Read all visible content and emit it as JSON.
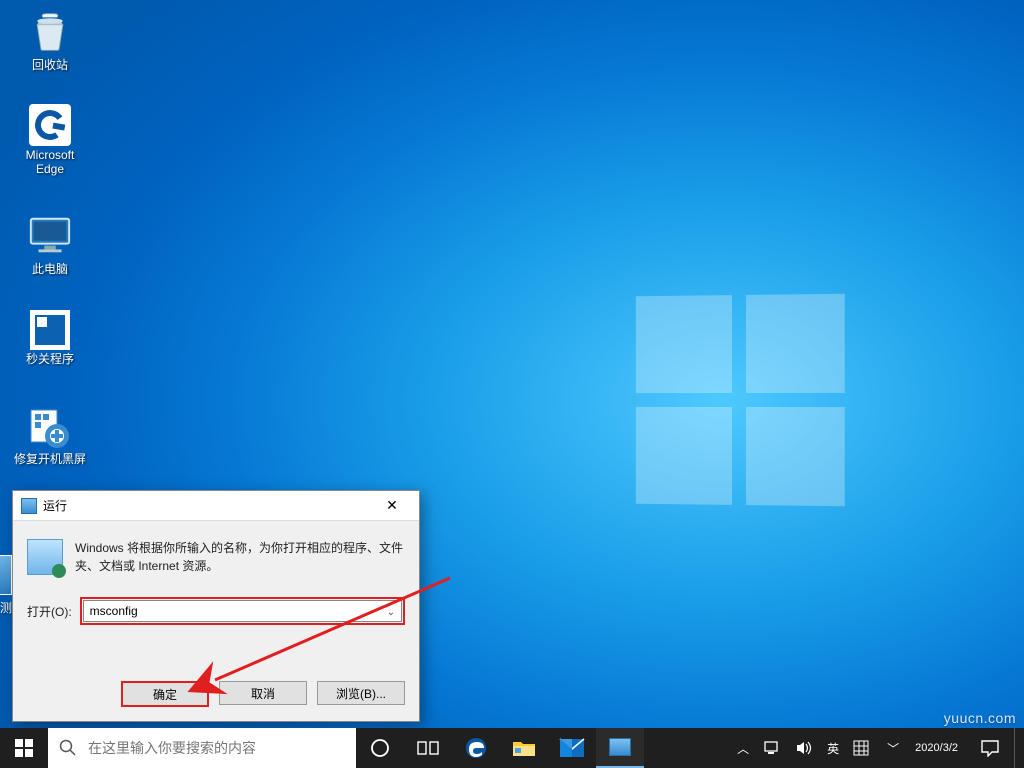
{
  "desktop_icons": {
    "recycle_bin": "回收站",
    "edge": "Microsoft\nEdge",
    "this_pc": "此电脑",
    "app_shutdown": "秒关程序",
    "app_fixblack": "修复开机黑屏",
    "app_cut": "测"
  },
  "run_dialog": {
    "title": "运行",
    "description": "Windows 将根据你所输入的名称，为你打开相应的程序、文件夹、文档或 Internet 资源。",
    "open_label": "打开(O):",
    "input_value": "msconfig",
    "ok": "确定",
    "cancel": "取消",
    "browse": "浏览(B)..."
  },
  "taskbar": {
    "search_placeholder": "在这里输入你要搜索的内容",
    "ime_lang": "英",
    "time": "",
    "date": "2020/3/2"
  },
  "watermark": "yuucn.com"
}
